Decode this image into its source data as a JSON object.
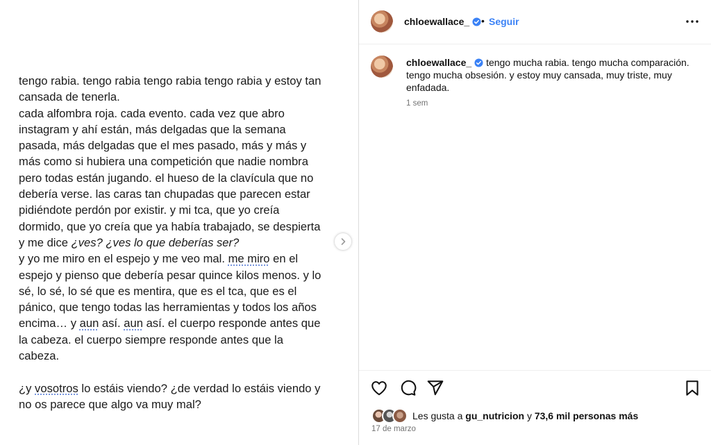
{
  "post": {
    "lines": [
      "tengo rabia. tengo rabia tengo rabia tengo rabia y estoy tan",
      "cansada de tenerla.",
      "cada alfombra roja. cada evento. cada vez que abro",
      "instagram y ahí están, más delgadas que la semana",
      "pasada, más delgadas que el mes pasado, más y más y",
      "más como si hubiera una competición que nadie nombra",
      "pero todas están jugando. el hueso de la clavícula que no",
      "debería verse. las caras tan chupadas que parecen estar",
      "pidiéndote perdón por existir. y mi tca, que yo creía",
      "dormido, que yo creía que ya había trabajado, se despierta"
    ],
    "line11_pre": "y me dice ",
    "line11_italic": "¿ves? ¿ves lo que deberías ser?",
    "line12_pre": "y yo me miro en el espejo y me veo mal. ",
    "line12_u": "me miro",
    "line12_post": " en el",
    "line13": "espejo y pienso que debería pesar quince kilos menos. y lo",
    "line14": "sé, lo sé, lo sé que es mentira, que es el tca, que es el",
    "line15": "pánico, que tengo todas las herramientas y todos los años",
    "line16_pre": "encima… y ",
    "line16_u1": "aun",
    "line16_mid": " así. ",
    "line16_u2": "aun",
    "line16_post": " así. el cuerpo responde antes que",
    "line17": "la cabeza. el cuerpo siempre responde antes que la",
    "line18": "cabeza.",
    "line20_pre": "¿y ",
    "line20_u": "vosotros",
    "line20_post": " lo estáis viendo? ¿de verdad lo estáis viendo y",
    "line21": "no os parece que algo va muy mal?"
  },
  "header": {
    "username": "chloewallace_",
    "dot": "•",
    "follow_label": "Seguir"
  },
  "caption": {
    "username": "chloewallace_",
    "text": "tengo mucha rabia. tengo mucha comparación. tengo mucha obsesión. y estoy muy cansada, muy triste, muy enfadada.",
    "time": "1 sem"
  },
  "likes": {
    "prefix": "Les gusta a ",
    "user": "gu_nutricion",
    "middle": " y ",
    "count": "73,6 mil personas más"
  },
  "date": "17 de marzo",
  "colors": {
    "accent": "#3b82f6",
    "muted": "#737373",
    "divider": "#dbdbdb"
  }
}
